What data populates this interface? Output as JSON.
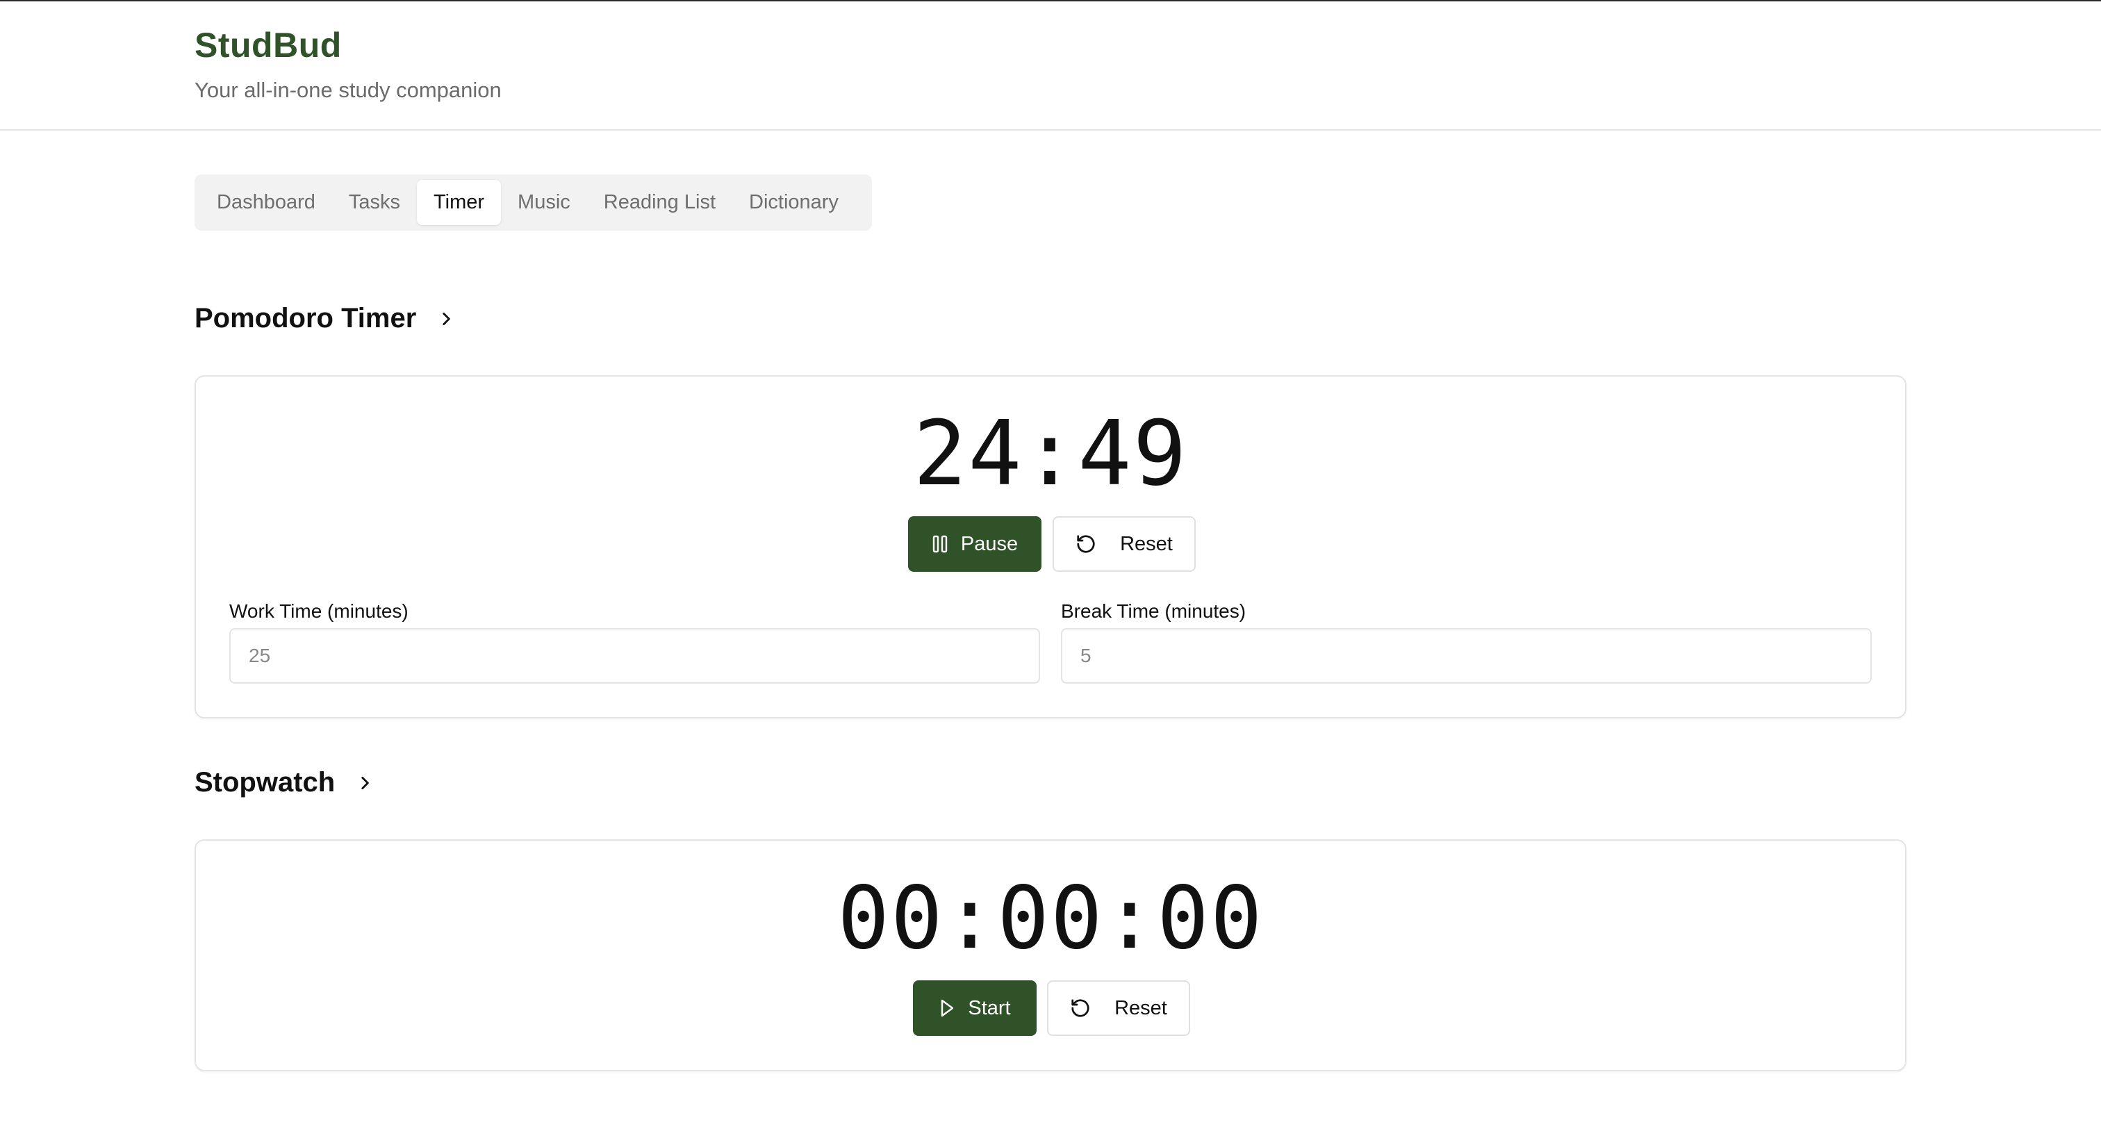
{
  "app": {
    "title": "StudBud",
    "tagline": "Your all-in-one study companion"
  },
  "tabs": [
    {
      "label": "Dashboard",
      "active": false
    },
    {
      "label": "Tasks",
      "active": false
    },
    {
      "label": "Timer",
      "active": true
    },
    {
      "label": "Music",
      "active": false
    },
    {
      "label": "Reading List",
      "active": false
    },
    {
      "label": "Dictionary",
      "active": false
    }
  ],
  "pomodoro": {
    "title": "Pomodoro Timer",
    "display": "24:49",
    "pause_label": "Pause",
    "reset_label": "Reset",
    "work_label": "Work Time (minutes)",
    "work_value": "25",
    "break_label": "Break Time (minutes)",
    "break_value": "5"
  },
  "stopwatch": {
    "title": "Stopwatch",
    "display": "00:00:00",
    "start_label": "Start",
    "reset_label": "Reset"
  },
  "colors": {
    "brand": "#2f5228",
    "border": "#e4e4e4",
    "tab_bar": "#f2f2f2",
    "muted_text": "#6b6b6b"
  },
  "icons": {
    "pause": "pause-icon",
    "play": "play-icon",
    "reset": "rotate-ccw-icon",
    "chevron": "chevron-right-icon"
  }
}
